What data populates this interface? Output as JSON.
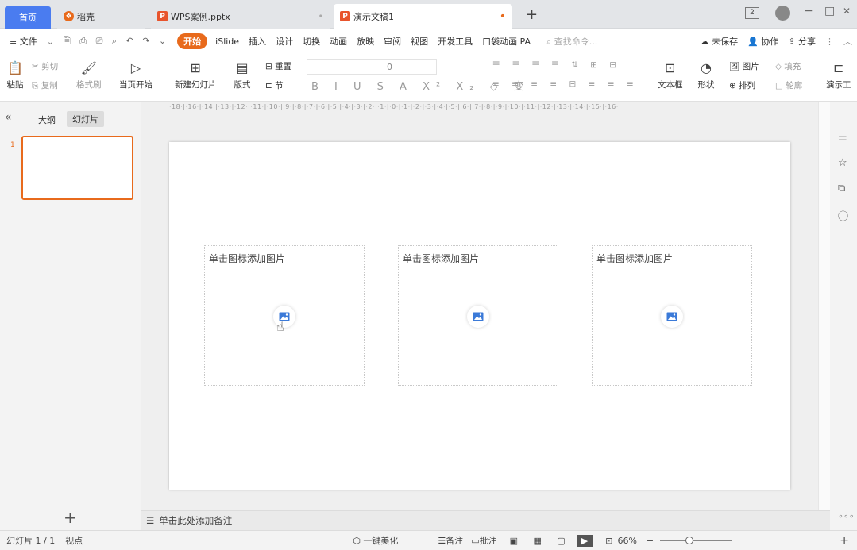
{
  "tabs": {
    "home": "首页",
    "daoke": "稻壳",
    "file1": "WPS案例.pptx",
    "file2": "演示文稿1",
    "add": "+"
  },
  "window": {
    "badge": "2",
    "minimize": "−",
    "restore": "□",
    "close": "✕"
  },
  "menu": {
    "hamburger": "≡ 文件",
    "items": [
      "开始",
      "iSlide",
      "插入",
      "设计",
      "切换",
      "动画",
      "放映",
      "审阅",
      "视图",
      "开发工具",
      "口袋动画 PA"
    ],
    "search_placeholder": "查找命令...",
    "unsaved": "未保存",
    "collab": "协作",
    "share": "分享"
  },
  "ribbon": {
    "paste": "粘贴",
    "cut": "剪切",
    "copy": "复制",
    "format_painter": "格式刷",
    "from_current": "当页开始",
    "new_slide": "新建幻灯片",
    "layout": "版式",
    "section": "节",
    "reset": "重置",
    "font_size": "0",
    "textbox": "文本框",
    "shapes": "形状",
    "picture": "图片",
    "arrange": "排列",
    "fill": "填充",
    "outline": "轮廓",
    "present": "演示工"
  },
  "left_panel": {
    "collapse": "«",
    "outline": "大纲",
    "slides": "幻灯片",
    "slide_number": "1",
    "add": "+"
  },
  "ruler_text": "·18·|·16·|·14·|·13·|·12·|·11·|·10·|·9·|·8·|·7·|·6·|·5·|·4·|·3·|·2·|·1·|·0·|·1·|·2·|·3·|·4·|·5·|·6·|·7·|·8·|·9·|·10·|·11·|·12·|·13·|·14·|·15·|·16·",
  "placeholders": [
    "单击图标添加图片",
    "单击图标添加图片",
    "单击图标添加图片"
  ],
  "notes": "单击此处添加备注",
  "status": {
    "slide_info": "幻灯片 1 / 1",
    "theme": "视点",
    "beautify": "一键美化",
    "notes": "备注",
    "comments": "批注",
    "zoom": "66%"
  },
  "colors": {
    "accent": "#e86a1c",
    "home_tab": "#4a7cf0",
    "pic_icon": "#3b7ad8"
  }
}
